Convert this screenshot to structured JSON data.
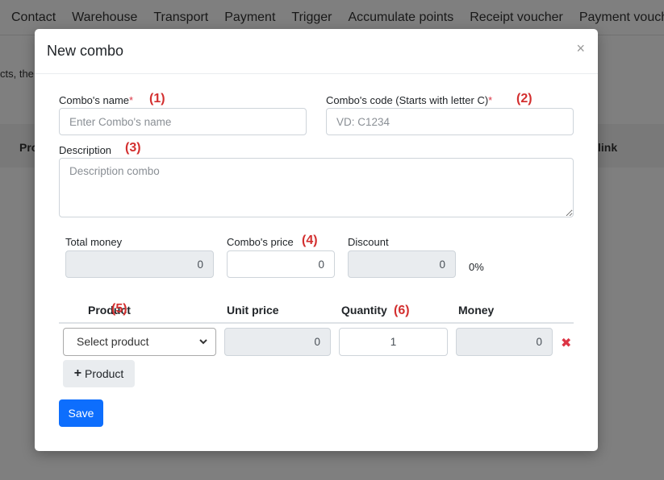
{
  "background": {
    "nav_items": [
      "Contact",
      "Warehouse",
      "Transport",
      "Payment",
      "Trigger",
      "Accumulate points",
      "Receipt voucher",
      "Payment voucher"
    ],
    "partial_text": "cts, the",
    "table_header_left": "Pro",
    "table_header_right": "link"
  },
  "modal": {
    "title": "New combo",
    "close_symbol": "×",
    "name_label": "Combo's name",
    "name_required": "*",
    "name_anno": "(1)",
    "name_placeholder": "Enter Combo's name",
    "code_label": "Combo's code (Starts with letter C)",
    "code_required": "*",
    "code_anno": "(2)",
    "code_placeholder": "VD: C1234",
    "desc_label": "Description",
    "desc_anno": "(3)",
    "desc_placeholder": "Description combo",
    "total_label": "Total money",
    "total_value": "0",
    "price_label": "Combo's price",
    "price_anno": "(4)",
    "price_value": "0",
    "discount_label": "Discount",
    "discount_value": "0",
    "discount_percent": "0%",
    "table": {
      "product_header": "Product",
      "product_anno": "(5)",
      "unit_price_header": "Unit price",
      "quantity_header": "Quantity",
      "quantity_anno": "(6)",
      "money_header": "Money",
      "row": {
        "select_value": "Select product",
        "unit_price": "0",
        "quantity": "1",
        "money": "0",
        "delete_symbol": "✖"
      }
    },
    "add_product_plus": "+",
    "add_product_label": "Product",
    "save_label": "Save"
  },
  "colors": {
    "primary": "#0d6efd",
    "annotation": "#d32f2f",
    "required": "#dc3545",
    "readonly_bg": "#e9ecef"
  },
  "icons": {
    "close": "close-icon",
    "delete": "delete-icon",
    "plus": "plus-icon",
    "chevron": "chevron-down-icon"
  }
}
